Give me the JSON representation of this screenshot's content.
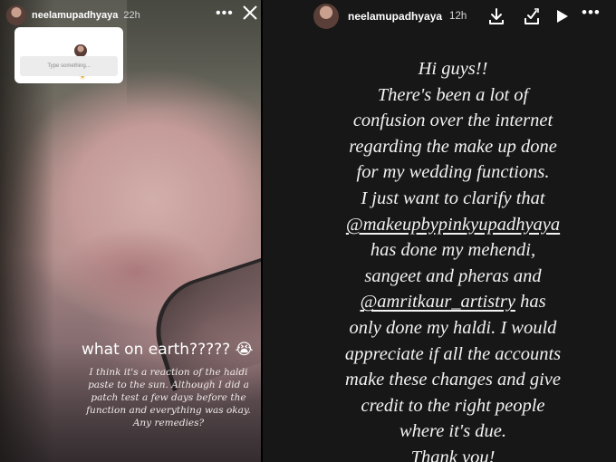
{
  "left_story": {
    "username": "neelamupadhyaya",
    "time": "22h",
    "sticker": {
      "emoji": "☀",
      "placeholder": "Type something..."
    },
    "caption_main": "what on earth????? 😭",
    "caption_lines": [
      "I think it's a reaction of the haldi",
      "paste to the sun. Although I did a",
      "patch test a few days before the",
      "function and everything was okay.",
      "Any remedies?"
    ],
    "icons": [
      "more-icon",
      "close-icon"
    ]
  },
  "right_story": {
    "username": "neelamupadhyaya",
    "time": "12h",
    "icons": [
      "download-icon",
      "download-check-icon",
      "play-icon",
      "more-icon"
    ],
    "lines": [
      "Hi guys!!",
      "There's been a lot of",
      "confusion over the internet",
      "regarding the make up done",
      "for my wedding functions.",
      "I just want to clarify that",
      "@makeupbypinkyupadhyaya",
      "has done my mehendi,",
      "sangeet and pheras and",
      "@amritkaur_artistry",
      " has",
      "only done my haldi. I would",
      "appreciate if all the accounts",
      "make these changes and give",
      "credit to the right people",
      "where it's due.",
      "Thank you!"
    ]
  }
}
